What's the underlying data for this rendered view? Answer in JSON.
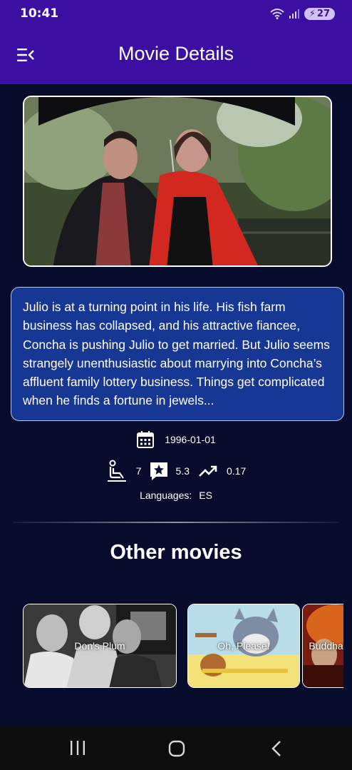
{
  "status_bar": {
    "time": "10:41",
    "battery": "27"
  },
  "app_bar": {
    "title": "Movie Details",
    "menu_icon": "menu-icon"
  },
  "movie": {
    "overview": "Julio is at a turning point in his life. His fish farm business has collapsed, and his attractive fiancee, Concha is pushing Julio to get married. But Julio seems strangely unenthusiastic about marrying into Concha’s affluent family lottery business. Things get complicated when he finds a fortune in jewels...",
    "release_date": "1996-01-01",
    "vote_count": "7",
    "vote_average": "5.3",
    "popularity": "0.17",
    "languages_label": "Languages:",
    "languages": "ES"
  },
  "other_movies": {
    "title": "Other movies",
    "items": [
      {
        "title": "Don's Plum"
      },
      {
        "title": "Oh, Please!"
      },
      {
        "title": "Buddha's P"
      }
    ]
  },
  "colors": {
    "primary": "#3a0fa2",
    "background": "#070b2c",
    "card": "#163793"
  }
}
